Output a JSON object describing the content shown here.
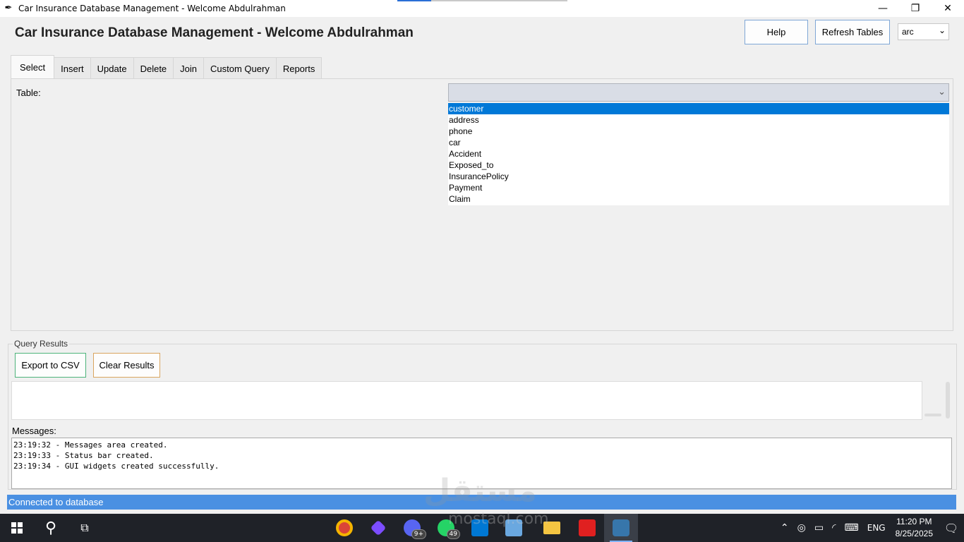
{
  "window": {
    "title": "Car Insurance Database Management - Welcome Abdulrahman",
    "controls": {
      "minimize": "—",
      "maximize": "❐",
      "close": "✕"
    }
  },
  "header": {
    "title": "Car Insurance Database Management - Welcome Abdulrahman",
    "help_label": "Help",
    "refresh_label": "Refresh Tables",
    "theme_value": "arc"
  },
  "tabs": [
    {
      "label": "Select",
      "active": true
    },
    {
      "label": "Insert"
    },
    {
      "label": "Update"
    },
    {
      "label": "Delete"
    },
    {
      "label": "Join"
    },
    {
      "label": "Custom Query"
    },
    {
      "label": "Reports"
    }
  ],
  "select_tab": {
    "table_label": "Table:",
    "table_value": "",
    "options": [
      "customer",
      "address",
      "phone",
      "car",
      "Accident",
      "Exposed_to",
      "InsurancePolicy",
      "Payment",
      "Claim"
    ],
    "selected_index": 0
  },
  "results": {
    "frame_title": "Query Results",
    "export_label": "Export to CSV",
    "clear_label": "Clear Results"
  },
  "messages": {
    "label": "Messages:",
    "lines": [
      "23:19:32 - Messages area created.",
      "23:19:33 - Status bar created.",
      "23:19:34 - GUI widgets created successfully."
    ]
  },
  "status": {
    "text": "Connected to database"
  },
  "taskbar": {
    "whatsapp_badge": "49",
    "discord_badge": "9+",
    "language": "ENG",
    "time": "11:20 PM",
    "date": "8/25/2025",
    "icon_colors": {
      "chrome": "#db4437",
      "obsidian": "#7c4dff",
      "discord": "#5865f2",
      "whatsapp": "#25d366",
      "vscode": "#0078d4",
      "notepad": "#6aa8e0",
      "explorer": "#f4c542",
      "acrobat": "#e02020",
      "python": "#3776ab"
    }
  },
  "watermark": {
    "text": "مستقل",
    "sub": "mostaql.com"
  }
}
